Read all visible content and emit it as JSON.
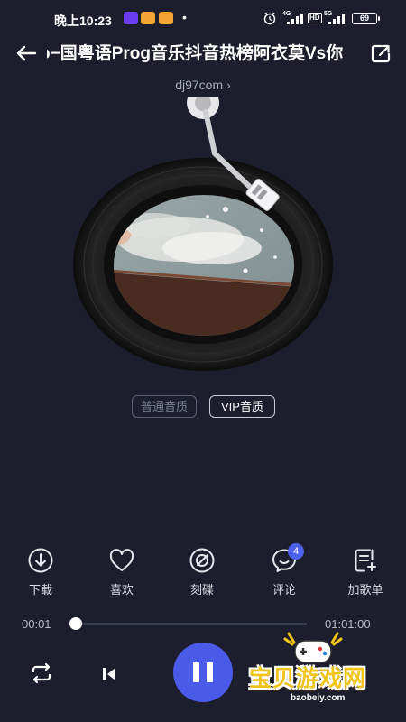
{
  "status_bar": {
    "time": "晚上10:23",
    "dot": "•",
    "network_1": "4G",
    "hd": "HD",
    "network_2": "5G",
    "battery": "69"
  },
  "header": {
    "title": "o−国粤语Prog音乐抖音热榜阿衣莫Vs你",
    "source": "dj97com",
    "source_chevron": "›"
  },
  "quality": {
    "normal_label": "普通音质",
    "vip_label": "VIP音质",
    "selected": "VIP音质"
  },
  "actions": {
    "download": "下载",
    "like": "喜欢",
    "disc": "刻碟",
    "comment": "评论",
    "comment_count": "4",
    "add_playlist": "加歌单"
  },
  "progress": {
    "current": "00:01",
    "total": "01:01:00",
    "fraction": 0.0003
  },
  "watermark": {
    "text": "宝贝游戏网",
    "url": "baobeiy.com"
  },
  "colors": {
    "background": "#1c1e2e",
    "accent": "#4a5bea",
    "badge": "#4d62ea"
  }
}
